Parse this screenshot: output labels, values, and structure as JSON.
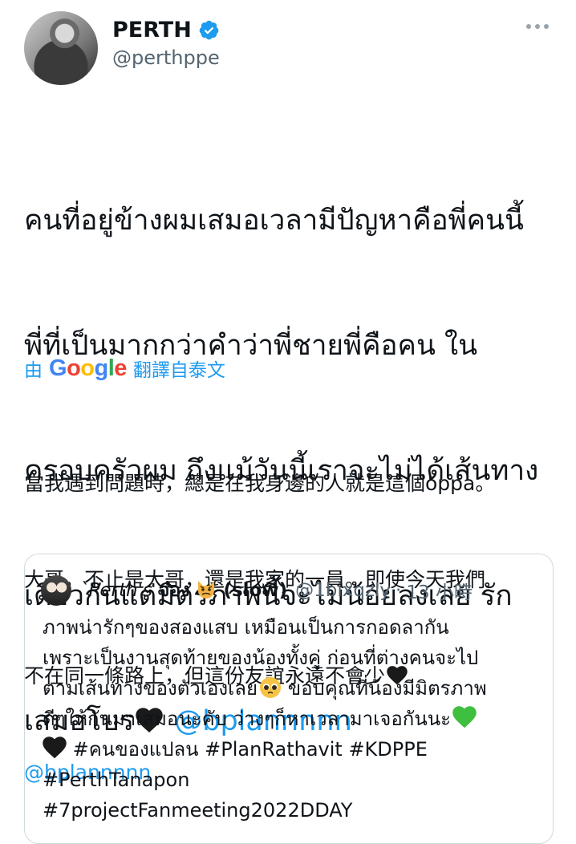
{
  "author": {
    "name": "PERTH",
    "handle": "@perthppe"
  },
  "tweet": {
    "line1": "คนที่อยู่ข้างผมเสมอเวลามีปัญหาคือพี่คนนี้",
    "line2": "พี่ที่เป็นมากกว่าคำว่าพี่ชายพี่คือคน ใน",
    "line3": "ครอบครัวผม ถึงแม้วันนี้เราจะไม่ได้เส้นทาง",
    "line4": "เดียวกันแต่มิตรภาพนี้จะไม่น้อยลงเลย รัก",
    "line5_text": "เสมอโบร",
    "line5_mention": "@bplannnnn"
  },
  "translation": {
    "by": "由",
    "provider": "Google",
    "label": "翻譯自泰文",
    "line1": "當我遇到問題時，總是在我身邊的人就是這個oppa。",
    "line2": "大哥，不止是大哥，還是我家的一員。即使今天我們",
    "line3": "不在同一條路上，但這份友誼永遠不會少",
    "mention": "@bplannnnn"
  },
  "quote": {
    "name_prefix": "`Perth's",
    "name_thai": "จ๋อง",
    "name_suffix": "(slow)",
    "handle": "@1bixqzly",
    "separator": "·",
    "time": "13 小時",
    "line1": "ภาพน่ารักๆของสองแสบ เหมือนเป็นการกอดลากัน",
    "line2": "เพราะเป็นงานสุดท้ายของน้องทั้งคู่ ก่อนที่ต่างคนจะไป",
    "line3": "ตามเส้นทางของตัวเองเลย",
    "line3b": " ขอบคุณที่น้องมีมิตรภาพ",
    "line4": "ดีๆให้กันมาเสมอนะคับ ว่างๆก็หาเวลามาเจอกันนะ",
    "line5": " #คนของแปลน #PlanRathavit #KDPPE",
    "line6": "#PerthTanapon",
    "line7": " #7projectFanmeeting2022DDAY"
  },
  "colors": {
    "link": "#1d9bf0",
    "secondary_text": "#536471",
    "border": "#cfd9de",
    "verified": "#1d9bf0"
  },
  "icons": {
    "verified": "verified-badge-icon",
    "more": "more-options-icon",
    "heart_black": "black-heart-icon",
    "heart_green": "green-heart-icon",
    "pleading_face": "pleading-face-icon",
    "cat_face": "cat-face-icon"
  }
}
